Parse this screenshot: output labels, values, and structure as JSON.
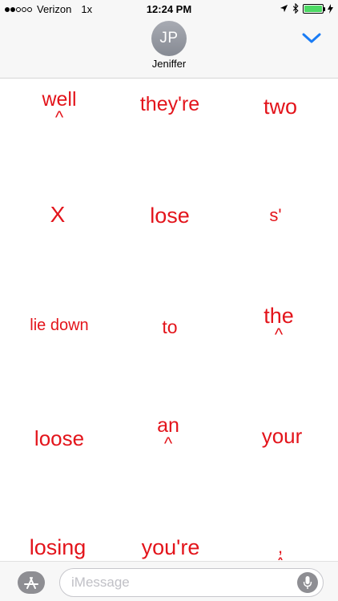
{
  "status_bar": {
    "carrier": "Verizon",
    "speed": "1x",
    "time": "12:24 PM"
  },
  "header": {
    "avatar_initials": "JP",
    "contact_name": "Jeniffer"
  },
  "stickers": [
    {
      "id": "well",
      "text": "well",
      "sub": "^"
    },
    {
      "id": "theyre",
      "text": "they're",
      "sub": ""
    },
    {
      "id": "two",
      "text": "two",
      "sub": ""
    },
    {
      "id": "x",
      "text": "X",
      "sub": ""
    },
    {
      "id": "lose",
      "text": "lose",
      "sub": ""
    },
    {
      "id": "s-apostrophe",
      "text": "s'",
      "sub": ""
    },
    {
      "id": "lie-down",
      "text": "lie down",
      "sub": ""
    },
    {
      "id": "to",
      "text": "to",
      "sub": ""
    },
    {
      "id": "the",
      "text": "the",
      "sub": "^"
    },
    {
      "id": "loose",
      "text": "loose",
      "sub": ""
    },
    {
      "id": "an",
      "text": "an",
      "sub": "^"
    },
    {
      "id": "your",
      "text": "your",
      "sub": ""
    },
    {
      "id": "losing",
      "text": "losing",
      "sub": ""
    },
    {
      "id": "youre",
      "text": "you're",
      "sub": ""
    },
    {
      "id": "comma",
      "text": ",",
      "sub": "^"
    }
  ],
  "composer": {
    "placeholder": "iMessage"
  },
  "icons": {
    "app_store": "app-store-icon",
    "mic": "microphone-icon",
    "chevron": "chevron-down-icon",
    "location": "location-arrow-icon",
    "bluetooth": "bluetooth-icon",
    "battery": "battery-charging-icon"
  },
  "colors": {
    "sticker_text": "#e3141b",
    "accent": "#1a7cf5",
    "battery_fill": "#4cd964"
  }
}
